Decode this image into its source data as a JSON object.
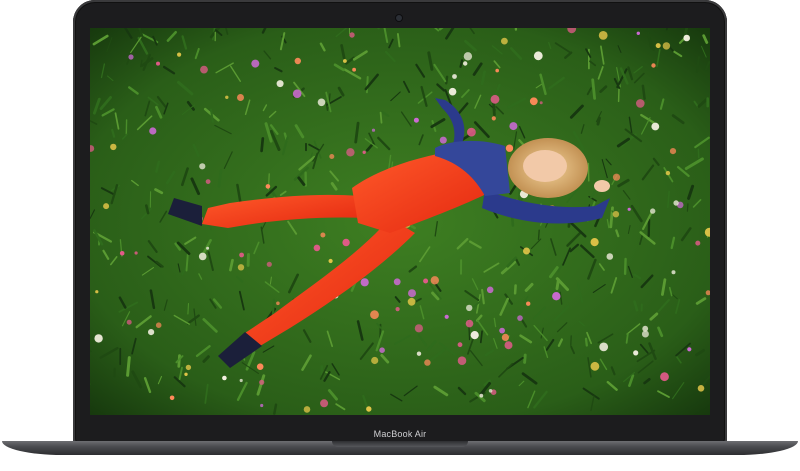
{
  "device": {
    "model_label": "MacBook Air",
    "bezel_color": "#1c1c1e",
    "base_color": "#4a4b4f"
  },
  "screen": {
    "scene": "photo",
    "palette": {
      "grass": "#2f6b1c",
      "grass_dark": "#173810",
      "jumpsuit": "#ff3b1f",
      "jacket": "#2b3a8c",
      "hair": "#e0b37a",
      "skin": "#f2c9a8",
      "flower_pink": "#e45a8a",
      "flower_white": "#f3efe0",
      "flower_yellow": "#e8c84a"
    }
  }
}
